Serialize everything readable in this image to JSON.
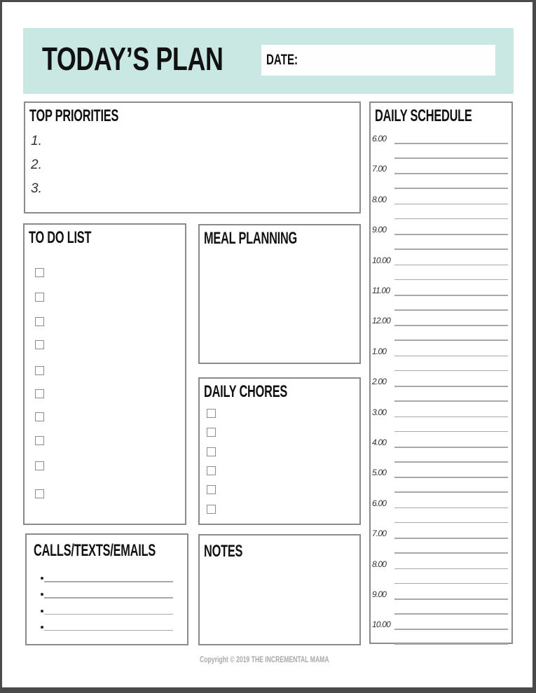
{
  "header": {
    "title": "TODAY’S PLAN",
    "date_label": "DATE:",
    "date_value": "",
    "band_color": "#c9e8e4"
  },
  "top_priorities": {
    "title": "TOP PRIORITIES",
    "items": [
      "1.",
      "2.",
      "3."
    ]
  },
  "daily_schedule": {
    "title": "DAILY SCHEDULE",
    "times": [
      "6.00",
      "7.00",
      "8.00",
      "9.00",
      "10.00",
      "11.00",
      "12.00",
      "1.00",
      "2.00",
      "3.00",
      "4.00",
      "5.00",
      "6.00",
      "7.00",
      "8.00",
      "9.00",
      "10.00"
    ]
  },
  "todo_list": {
    "title": "TO DO LIST",
    "checkbox_count": 10
  },
  "meal_planning": {
    "title": "MEAL PLANNING"
  },
  "daily_chores": {
    "title": "DAILY CHORES",
    "checkbox_count": 6
  },
  "calls_texts_emails": {
    "title": "CALLS/TEXTS/EMAILS",
    "line_count": 4
  },
  "notes": {
    "title": "NOTES"
  },
  "footer": {
    "copyright": "Copyright © 2019 THE INCREMENTAL MAMA"
  }
}
